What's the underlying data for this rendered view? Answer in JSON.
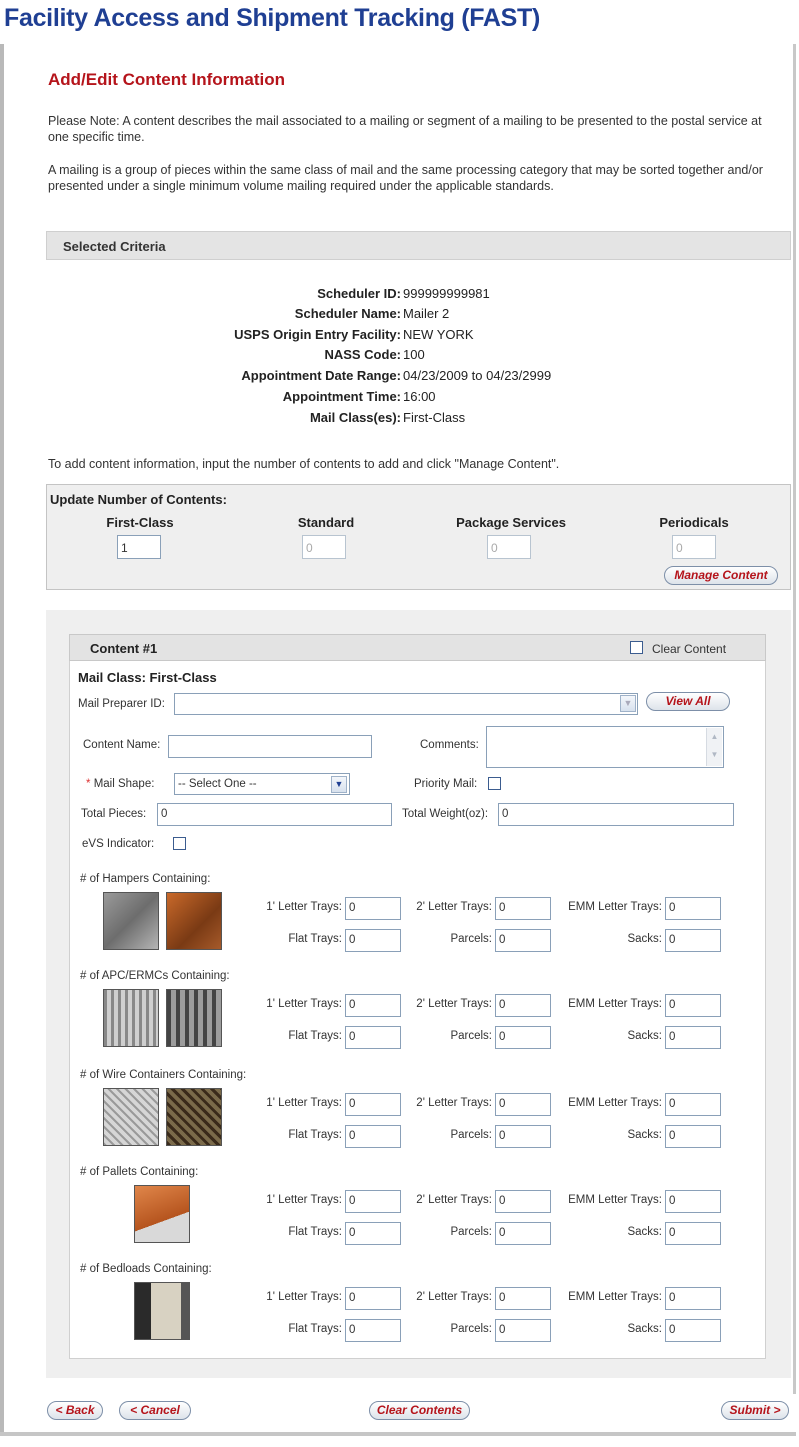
{
  "page": {
    "title": "Facility Access and Shipment Tracking (FAST)",
    "section_title": "Add/Edit Content Information",
    "note1": "Please Note: A content describes the mail associated to a mailing or segment of a mailing to be presented to the postal service at one specific time.",
    "note2": "A mailing is a group of pieces within the same class of mail and the same processing category that may be sorted together and/or presented under a single minimum volume mailing required under the applicable standards."
  },
  "criteria": {
    "header": "Selected Criteria",
    "rows": [
      {
        "label": "Scheduler ID:",
        "value": "999999999981"
      },
      {
        "label": "Scheduler Name:",
        "value": "Mailer 2"
      },
      {
        "label": "USPS Origin Entry Facility:",
        "value": "NEW YORK"
      },
      {
        "label": "NASS Code:",
        "value": "100"
      },
      {
        "label": "Appointment Date Range:",
        "value": "04/23/2009 to 04/23/2999"
      },
      {
        "label": "Appointment Time:",
        "value": "16:00"
      },
      {
        "label": "Mail Class(es):",
        "value": "First-Class"
      }
    ]
  },
  "instruction": "To add content information, input the number of contents to add and click \"Manage Content\".",
  "update": {
    "title": "Update Number of Contents:",
    "classes": [
      {
        "label": "First-Class",
        "value": "1"
      },
      {
        "label": "Standard",
        "value": "0"
      },
      {
        "label": "Package Services",
        "value": "0"
      },
      {
        "label": "Periodicals",
        "value": "0"
      }
    ],
    "manage_button": "Manage Content"
  },
  "content": {
    "title": "Content #1",
    "clear_content": "Clear Content",
    "mail_class": "Mail Class: First-Class",
    "preparer_label": "Mail Preparer ID:",
    "view_all": "View All",
    "content_name_label": "Content Name:",
    "comments_label": "Comments:",
    "mail_shape_label": "Mail Shape:",
    "mail_shape_value": "-- Select One --",
    "priority_label": "Priority Mail:",
    "total_pieces_label": "Total Pieces:",
    "total_pieces_value": "0",
    "total_weight_label": "Total Weight(oz):",
    "total_weight_value": "0",
    "evs_label": "eVS Indicator:",
    "required_mark": "*"
  },
  "groups": [
    {
      "label": "# of Hampers Containing:"
    },
    {
      "label": "# of APC/ERMCs Containing:"
    },
    {
      "label": "# of Wire Containers Containing:"
    },
    {
      "label": "# of Pallets Containing:"
    },
    {
      "label": "# of Bedloads Containing:"
    }
  ],
  "tray_labels": {
    "t1": "1' Letter Trays:",
    "t2": "2' Letter Trays:",
    "emm": "EMM Letter Trays:",
    "flat": "Flat Trays:",
    "parcels": "Parcels:",
    "sacks": "Sacks:"
  },
  "tray_default": "0",
  "buttons": {
    "back": "< Back",
    "cancel": "< Cancel",
    "clear_contents": "Clear Contents",
    "submit": "Submit >"
  }
}
